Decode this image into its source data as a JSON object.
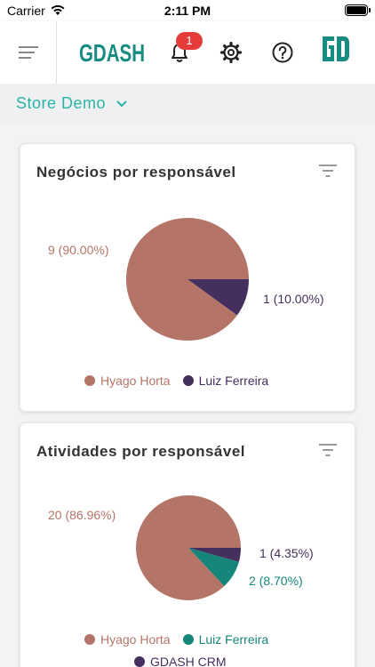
{
  "status_bar": {
    "carrier": "Carrier",
    "time": "2:11 PM"
  },
  "header": {
    "logo_text": "GDASH",
    "notification_count": "1",
    "icons": [
      "menu-icon",
      "bell-icon",
      "gear-icon",
      "help-circle-icon",
      "gdash-mark-icon"
    ]
  },
  "store": {
    "name": "Store Demo"
  },
  "colors": {
    "accent": "#2ab3a6",
    "hyago": "#b57468",
    "luiz_1": "#452f5e",
    "luiz_2": "#16857a",
    "gdash": "#452f5e",
    "badge": "#e53b3b"
  },
  "charts": [
    {
      "title": "Negócios por responsável",
      "labels": [
        "9 (90.00%)",
        "1 (10.00%)"
      ],
      "legend": [
        "Hyago Horta",
        "Luiz Ferreira"
      ]
    },
    {
      "title": "Atividades por responsável",
      "labels": [
        "20 (86.96%)",
        "1 (4.35%)",
        "2 (8.70%)"
      ],
      "legend": [
        "Hyago Horta",
        "Luiz Ferreira",
        "GDASH CRM"
      ]
    }
  ],
  "chart_data": [
    {
      "type": "pie",
      "title": "Negócios por responsável",
      "categories": [
        "Hyago Horta",
        "Luiz Ferreira"
      ],
      "values": [
        9,
        1
      ],
      "percentages": [
        90.0,
        10.0
      ],
      "colors": [
        "#b57468",
        "#452f5e"
      ],
      "legend_position": "bottom"
    },
    {
      "type": "pie",
      "title": "Atividades por responsável",
      "categories": [
        "Hyago Horta",
        "GDASH CRM",
        "Luiz Ferreira"
      ],
      "values": [
        20,
        1,
        2
      ],
      "percentages": [
        86.96,
        4.35,
        8.7
      ],
      "colors": [
        "#b57468",
        "#452f5e",
        "#16857a"
      ],
      "legend_position": "bottom"
    }
  ]
}
